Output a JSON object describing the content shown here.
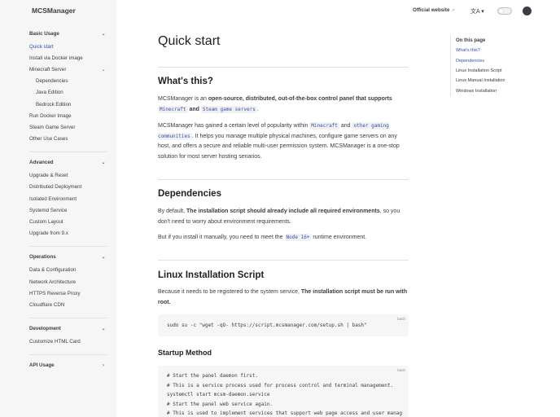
{
  "brand": "MCSManager",
  "topbar": {
    "official_link": "Official website",
    "ext_icon": "↗",
    "lang_icon": "文A ▾"
  },
  "sidebar": {
    "groups": [
      {
        "title": "Basic Usage",
        "items": [
          {
            "label": "Quick start",
            "active": true
          },
          {
            "label": "Install via Docker image"
          },
          {
            "label": "Minecraft Server",
            "expandable": true
          },
          {
            "label": "Dependencies",
            "sub": true
          },
          {
            "label": "Java Edition",
            "sub": true
          },
          {
            "label": "Bedrock Edition",
            "sub": true
          },
          {
            "label": "Run Docker Image"
          },
          {
            "label": "Steam Game Server"
          },
          {
            "label": "Other Use Cases"
          }
        ]
      },
      {
        "title": "Advanced",
        "items": [
          {
            "label": "Upgrade & Reset"
          },
          {
            "label": "Distributed Deployment"
          },
          {
            "label": "Isolated Environment"
          },
          {
            "label": "Systemd Service"
          },
          {
            "label": "Custom Layout"
          },
          {
            "label": "Upgrade from 9.x"
          }
        ]
      },
      {
        "title": "Operations",
        "items": [
          {
            "label": "Data & Configuration"
          },
          {
            "label": "Network Architecture"
          },
          {
            "label": "HTTPS Reverse Proxy"
          },
          {
            "label": "Cloudflare CDN"
          }
        ]
      },
      {
        "title": "Development",
        "items": [
          {
            "label": "Customize HTML Card"
          }
        ]
      },
      {
        "title": "API Usage",
        "items": []
      }
    ]
  },
  "main": {
    "title": "Quick start",
    "whats_this": {
      "heading": "What's this?",
      "p1_a": "MCSManager is an ",
      "p1_b": "open-source, distributed, out-of-the-box control panel that supports",
      "p1_code1": "Minecraft",
      "p1_c": " and ",
      "p1_code2": "Steam game servers",
      "p1_d": ".",
      "p2_a": "MCSManager has gained a certain level of popularity within ",
      "p2_code1": "Minecraft",
      "p2_b": " and ",
      "p2_code2": "other gaming communities",
      "p2_c": ". It helps you manage multiple physical machines, configure game servers on any host, and offers a secure and reliable multi-user permission system. MCSManager is a one-stop solution for most server hosting senarios."
    },
    "dependencies": {
      "heading": "Dependencies",
      "p1_a": "By default, ",
      "p1_b": "The installation script should already include all required environments",
      "p1_c": ", so you don't need to worry about environment requirements.",
      "p2_a": "But if you install it manually, you need to meet the ",
      "p2_code": "Node 16+",
      "p2_b": " runtime environment."
    },
    "linux_script": {
      "heading": "Linux Installation Script",
      "p1_a": "Because it needs to be registered to the system service, ",
      "p1_b": "The installation script must be run with root.",
      "code_lang": "bash",
      "code": "sudo su -c \"wget -qO- https://script.mcsmanager.com/setup.sh | bash\""
    },
    "startup": {
      "heading": "Startup Method",
      "code_lang": "bash",
      "code": "# Start the panel daemon first.\n# This is a service process used for process control and terminal management.\nsystemctl start mcsm-daemon.service\n# Start the panel web service again.\n# This is used to implement services that support web page access and user manag"
    }
  },
  "toc": {
    "title": "On this page",
    "items": [
      {
        "label": "What's this?",
        "active": true
      },
      {
        "label": "Dependencies",
        "active": true
      },
      {
        "label": "Linux Installation Script"
      },
      {
        "label": "Linux Manual Installation"
      },
      {
        "label": "Windows Installation"
      }
    ]
  }
}
